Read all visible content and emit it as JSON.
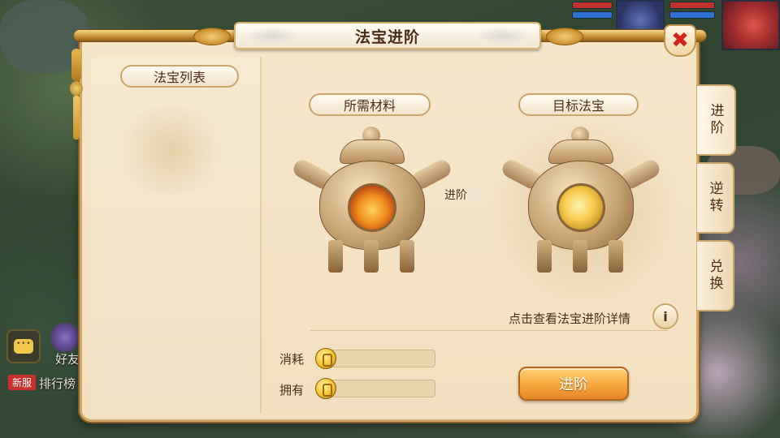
{
  "window": {
    "title": "法宝进阶"
  },
  "left_panel": {
    "title": "法宝列表"
  },
  "materials": {
    "title": "所需材料",
    "core": "fire"
  },
  "target": {
    "title": "目标法宝",
    "core": "gold"
  },
  "arrow_label": "进阶",
  "detail_link": "点击查看法宝进阶详情",
  "info_icon": "i",
  "cost": {
    "label": "消耗",
    "value": ""
  },
  "owned": {
    "label": "拥有",
    "value": ""
  },
  "advance_button": "进阶",
  "tabs": [
    {
      "label": "进阶",
      "active": true
    },
    {
      "label": "逆转",
      "active": false
    },
    {
      "label": "兑换",
      "active": false
    }
  ],
  "close_icon": "✖",
  "hud": {
    "friends": "好友",
    "ranking_badge": "新服",
    "ranking": "排行榜"
  },
  "colors": {
    "accent": "#f6a73a",
    "panel_bg": "#f6e6c9",
    "text": "#4b2d16",
    "close": "#d3231c"
  }
}
